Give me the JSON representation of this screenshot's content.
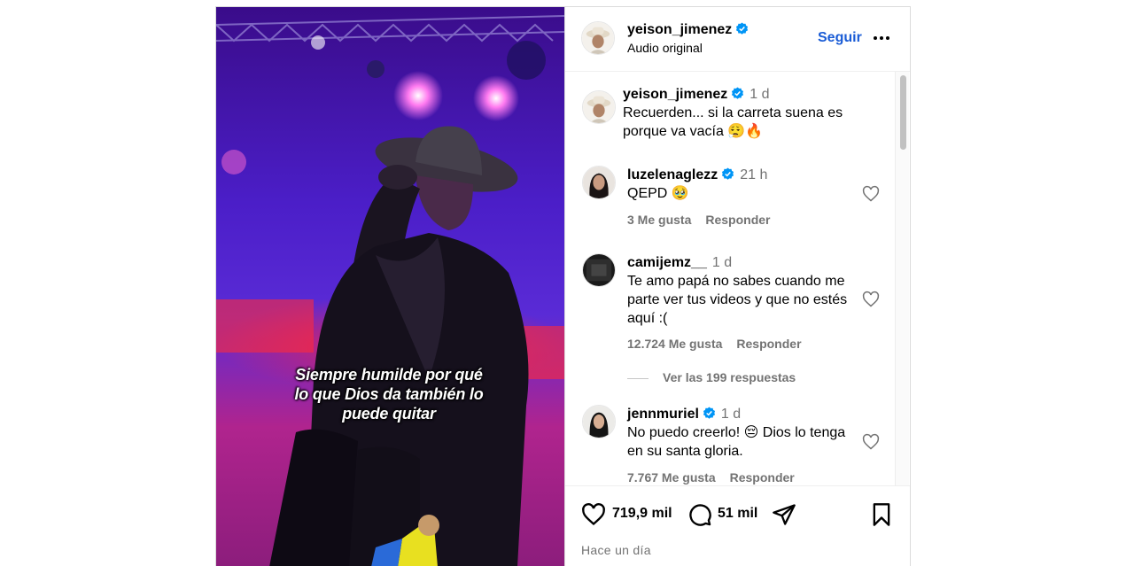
{
  "post": {
    "caption_overlay": "Siempre humilde por qué\nlo que Dios da también lo\npuede quitar",
    "author": {
      "username": "yeison_jimenez",
      "subtitle": "Audio original",
      "follow_label": "Seguir",
      "more_icon": "more-horizontal-icon"
    },
    "comments": [
      {
        "username": "yeison_jimenez",
        "verified": true,
        "time": "1 d",
        "text": "Recuerden... si la carreta suena es porque va vacía 😮‍💨🔥"
      },
      {
        "username": "luzelenaglezz",
        "verified": true,
        "time": "21 h",
        "text": "QEPD 🥹",
        "likes": "3 Me gusta",
        "reply_label": "Responder"
      },
      {
        "username": "camijemz__",
        "verified": false,
        "time": "1 d",
        "text": "Te amo papá no sabes cuando me parte ver tus videos y que no estés aquí :(",
        "likes": "12.724 Me gusta",
        "reply_label": "Responder",
        "view_replies": "Ver las 199 respuestas"
      },
      {
        "username": "jennmuriel",
        "verified": true,
        "time": "1 d",
        "text": "No puedo creerlo! 😔 Dios lo tenga en su santa gloria.",
        "likes": "7.767 Me gusta",
        "reply_label": "Responder"
      }
    ],
    "actions": {
      "like_count": "719,9 mil",
      "comment_count": "51 mil",
      "posted": "Hace un día"
    },
    "colors": {
      "follow": "#1a5cd6",
      "verified": "#0095f6",
      "muted": "#737373"
    }
  }
}
